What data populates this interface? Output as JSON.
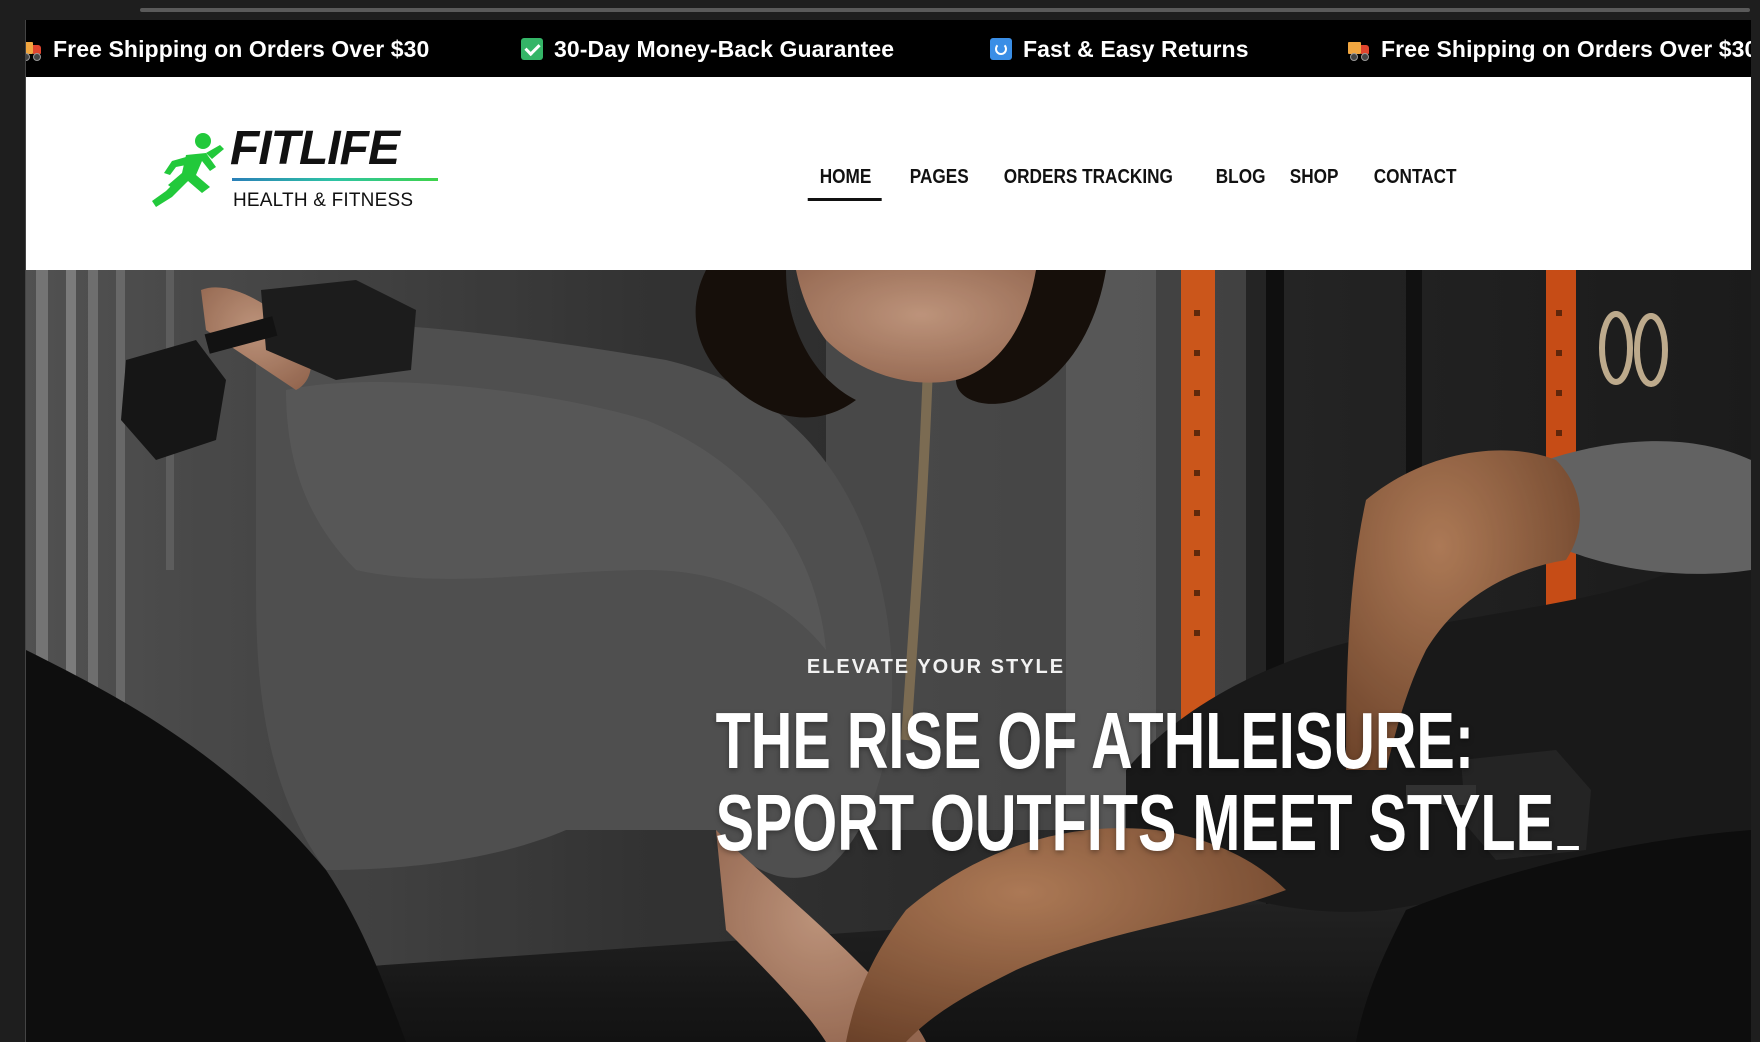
{
  "announcement_bar": {
    "items": [
      {
        "icon": "truck-icon",
        "text": "Free Shipping on Orders Over $30"
      },
      {
        "icon": "check-icon",
        "text": "30-Day Money-Back Guarantee"
      },
      {
        "icon": "refresh-icon",
        "text": "Fast & Easy Returns"
      },
      {
        "icon": "truck-icon",
        "text": "Free Shipping on Orders Over $30"
      }
    ],
    "background": "#000000",
    "text_color": "#ffffff"
  },
  "header": {
    "logo": {
      "title": "FITLIFE",
      "subtitle": "HEALTH & FITNESS",
      "icon": "running-man-icon",
      "accent": "#22c93b"
    },
    "nav": {
      "items": [
        {
          "label": "HOME",
          "active": true
        },
        {
          "label": "PAGES",
          "active": false
        },
        {
          "label": "ORDERS TRACKING",
          "active": false
        },
        {
          "label": "BLOG",
          "active": false
        },
        {
          "label": "SHOP",
          "active": false
        },
        {
          "label": "CONTACT",
          "active": false
        }
      ]
    }
  },
  "hero": {
    "eyebrow": "ELEVATE YOUR STYLE",
    "title_line1": "THE RISE OF ATHLEISURE:",
    "title_line2": "SPORT OUTFITS MEET STYLE",
    "accent_orange": "#e8621f"
  }
}
